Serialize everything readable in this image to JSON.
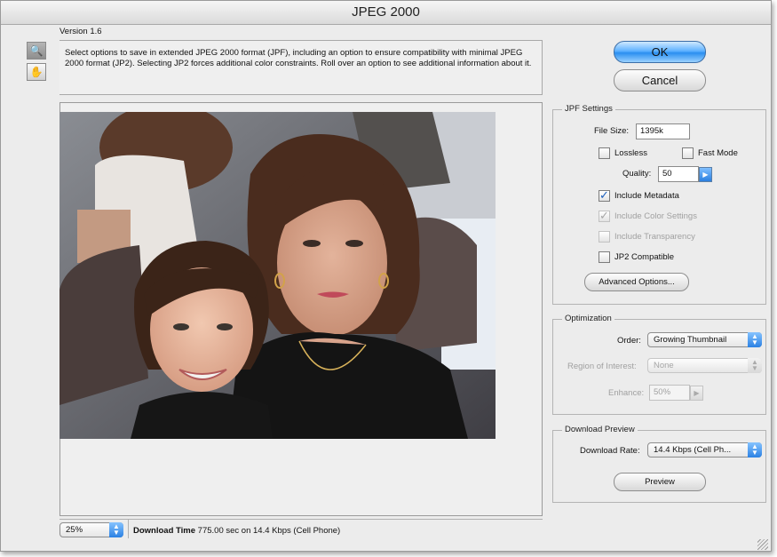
{
  "window": {
    "title": "JPEG 2000",
    "version": "Version 1.6"
  },
  "tools": [
    {
      "name": "zoom-tool",
      "glyph": "🔍"
    },
    {
      "name": "hand-tool",
      "glyph": "✋"
    }
  ],
  "description": "Select options to save in extended JPEG 2000 format (JPF), including an option to ensure compatibility with minimal JPEG 2000 format (JP2). Selecting JP2 forces additional color constraints. Roll over an option to see additional information about it.",
  "buttons": {
    "ok": "OK",
    "cancel": "Cancel",
    "advanced": "Advanced Options...",
    "preview": "Preview"
  },
  "jpf_settings": {
    "title": "JPF Settings",
    "file_size_label": "File Size:",
    "file_size_value": "1395k",
    "lossless": {
      "label": "Lossless",
      "checked": false
    },
    "fast_mode": {
      "label": "Fast Mode",
      "checked": false
    },
    "quality_label": "Quality:",
    "quality_value": "50",
    "include_metadata": {
      "label": "Include Metadata",
      "checked": true
    },
    "include_color_settings": {
      "label": "Include Color Settings",
      "checked": true,
      "disabled": true
    },
    "include_transparency": {
      "label": "Include Transparency",
      "checked": false,
      "disabled": true
    },
    "jp2_compatible": {
      "label": "JP2 Compatible",
      "checked": false
    }
  },
  "optimization": {
    "title": "Optimization",
    "order_label": "Order:",
    "order_value": "Growing Thumbnail",
    "roi_label": "Region of Interest:",
    "roi_value": "None",
    "enhance_label": "Enhance:",
    "enhance_value": "50%"
  },
  "download_preview": {
    "title": "Download Preview",
    "rate_label": "Download Rate:",
    "rate_value": "14.4 Kbps (Cell Ph..."
  },
  "status": {
    "zoom": "25%",
    "download_time_label": "Download Time",
    "download_time_value": "775.00 sec on 14.4 Kbps (Cell Phone)"
  },
  "colors": {
    "ok_button": "#4aa3ff",
    "checkmark": "#1c5fbd",
    "panel_bg": "#ececec"
  }
}
